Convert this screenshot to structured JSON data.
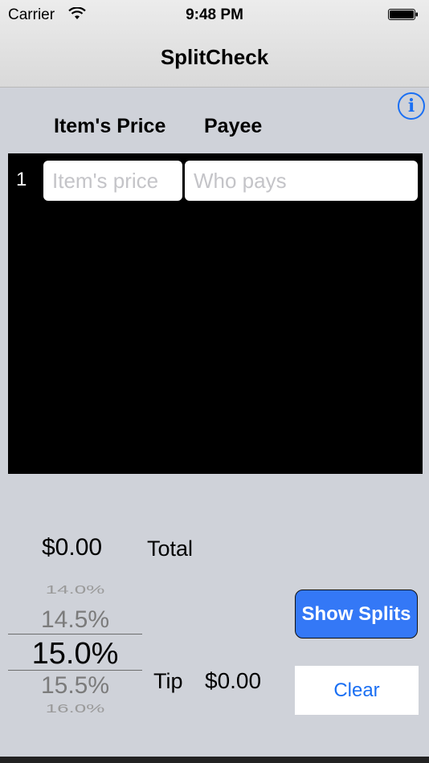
{
  "status_bar": {
    "carrier": "Carrier",
    "time": "9:48 PM"
  },
  "nav": {
    "title": "SplitCheck",
    "info_icon": "info-icon"
  },
  "table": {
    "headers": {
      "price": "Item's Price",
      "payee": "Payee"
    },
    "rows": [
      {
        "index": "1",
        "price_placeholder": "Item's price",
        "payee_placeholder": "Who pays",
        "price_value": "",
        "payee_value": ""
      }
    ]
  },
  "total": {
    "amount": "$0.00",
    "label": "Total"
  },
  "tip_picker": {
    "options": [
      "14.0%",
      "14.5%",
      "15.0%",
      "15.5%",
      "16.0%"
    ],
    "selected": "15.0%"
  },
  "tip": {
    "label": "Tip",
    "amount": "$0.00"
  },
  "buttons": {
    "show_splits": "Show Splits",
    "clear": "Clear"
  },
  "colors": {
    "accent": "#1a6ff3",
    "button_blue": "#3478f6",
    "background": "#cfd2d9"
  }
}
